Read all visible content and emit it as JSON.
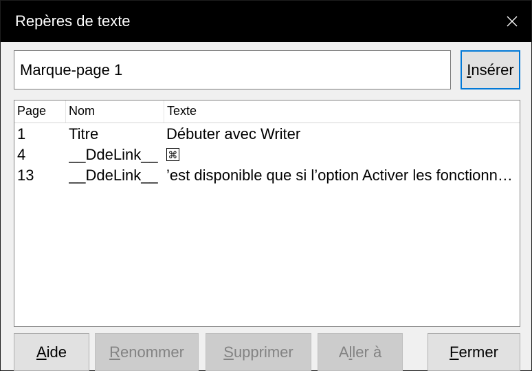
{
  "window": {
    "title": "Repères de texte",
    "close_icon": "close-icon"
  },
  "name_field": {
    "value": "Marque-page 1"
  },
  "insert_button": {
    "mnemonic": "I",
    "rest": "nsérer"
  },
  "table": {
    "headers": {
      "page": "Page",
      "name": "Nom",
      "text": "Texte"
    },
    "rows": [
      {
        "page": "1",
        "name": "Titre",
        "text": "Débuter avec Writer"
      },
      {
        "page": "4",
        "name": "__DdeLink__",
        "text": "⌘"
      },
      {
        "page": "13",
        "name": "__DdeLink__",
        "text": "’est disponible que si l’option Activer les fonctionnalités expérimentales"
      }
    ]
  },
  "buttons": {
    "help": {
      "mnemonic": "A",
      "rest": "ide"
    },
    "rename": {
      "mnemonic": "R",
      "rest": "enommer"
    },
    "delete": {
      "mnemonic": "S",
      "rest": "upprimer"
    },
    "goto": {
      "before": "A",
      "mnemonic": "l",
      "rest": "ler à"
    },
    "close": {
      "mnemonic": "F",
      "rest": "ermer"
    }
  },
  "colors": {
    "titlebar": "#000000",
    "dialog_bg": "#f0f0f0",
    "default_button_border": "#0078d7",
    "disabled_text": "#838383"
  }
}
